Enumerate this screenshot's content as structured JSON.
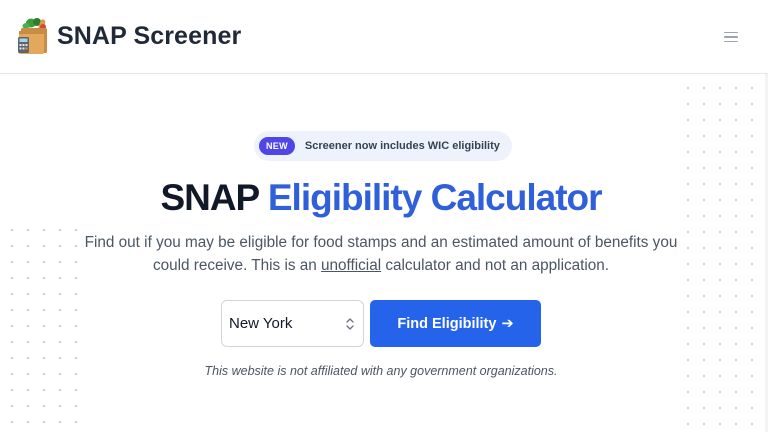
{
  "header": {
    "brand_name": "SNAP Screener",
    "logo_icon": "grocery-bag-icon",
    "menu_icon": "hamburger-menu-icon"
  },
  "announcement": {
    "pill_label": "NEW",
    "text": "Screener now includes WIC eligibility"
  },
  "hero": {
    "title_part1": "SNAP",
    "title_part2": "Eligibility Calculator",
    "subtitle_before": "Find out if you may be eligible for food stamps and an estimated amount of benefits you could receive. This is an ",
    "subtitle_underlined": "unofficial",
    "subtitle_after": " calculator and not an application."
  },
  "form": {
    "state_selected": "New York",
    "submit_label": "Find Eligibility",
    "submit_arrow": "➔"
  },
  "disclaimer": "This website is not affiliated with any government organizations.",
  "colors": {
    "accent": "#2563eb",
    "title_accent": "#2f5fd9",
    "badge_pill": "#4f46e5",
    "badge_bg": "#eef2fd",
    "text_dark": "#111827",
    "text_muted": "#4b5563"
  }
}
